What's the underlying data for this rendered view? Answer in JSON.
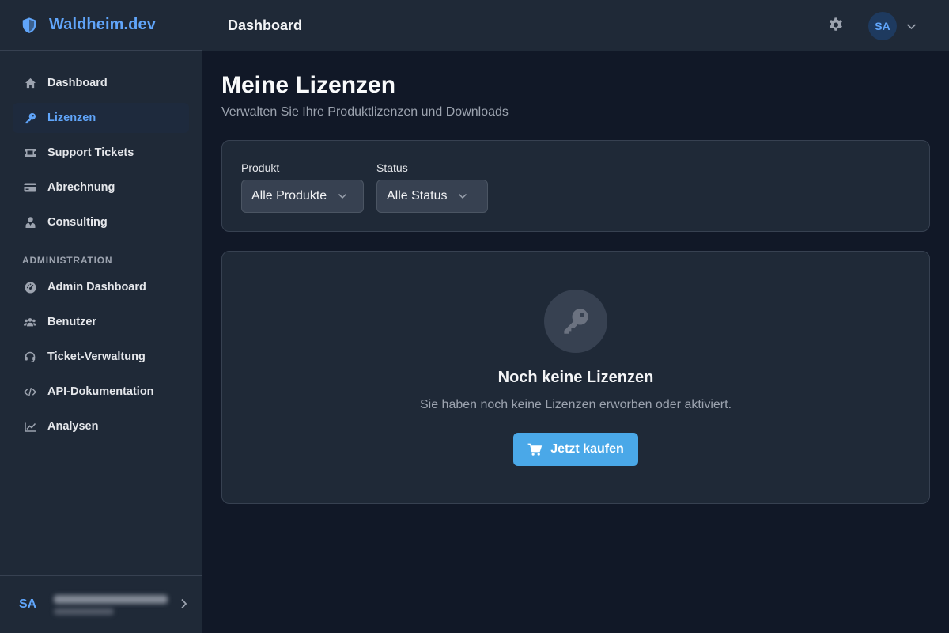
{
  "brand": {
    "name": "Waldheim.dev"
  },
  "sidebar": {
    "items": [
      {
        "label": "Dashboard",
        "icon": "home-icon"
      },
      {
        "label": "Lizenzen",
        "icon": "key-icon",
        "active": true
      },
      {
        "label": "Support Tickets",
        "icon": "ticket-icon"
      },
      {
        "label": "Abrechnung",
        "icon": "credit-card-icon"
      },
      {
        "label": "Consulting",
        "icon": "user-tie-icon"
      }
    ],
    "section": "ADMINISTRATION",
    "admin_items": [
      {
        "label": "Admin Dashboard",
        "icon": "gauge-icon"
      },
      {
        "label": "Benutzer",
        "icon": "users-icon"
      },
      {
        "label": "Ticket-Verwaltung",
        "icon": "headset-icon"
      },
      {
        "label": "API-Dokumentation",
        "icon": "code-icon"
      },
      {
        "label": "Analysen",
        "icon": "chart-line-icon"
      }
    ],
    "user": {
      "initials": "SA"
    }
  },
  "header": {
    "title": "Dashboard",
    "avatar_initials": "SA"
  },
  "main": {
    "title": "Meine Lizenzen",
    "subtitle": "Verwalten Sie Ihre Produktlizenzen und Downloads",
    "filters": {
      "product_label": "Produkt",
      "product_value": "Alle Produkte",
      "status_label": "Status",
      "status_value": "Alle Status"
    },
    "empty": {
      "title": "Noch keine Lizenzen",
      "text": "Sie haben noch keine Lizenzen erworben oder aktiviert.",
      "button": "Jetzt kaufen"
    }
  },
  "colors": {
    "accent": "#60a5fa",
    "button": "#4aa8e8",
    "sidebar_bg": "#1f2937",
    "page_bg": "#111827"
  }
}
